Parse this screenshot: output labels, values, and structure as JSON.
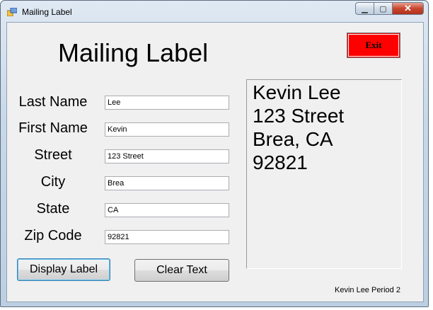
{
  "window": {
    "title": "Mailing Label",
    "minimize_glyph": "▁",
    "maximize_glyph": "▢",
    "close_glyph": "✕"
  },
  "form": {
    "heading": "Mailing Label",
    "exit_label": "Exit",
    "fields": {
      "last_name": {
        "label": "Last Name",
        "value": "Lee"
      },
      "first_name": {
        "label": "First Name",
        "value": "Kevin"
      },
      "street": {
        "label": "Street",
        "value": "123 Street"
      },
      "city": {
        "label": "City",
        "value": "Brea"
      },
      "state": {
        "label": "State",
        "value": "CA"
      },
      "zip": {
        "label": "Zip Code",
        "value": "92821"
      }
    },
    "display": {
      "line1": "Kevin Lee",
      "line2": "123 Street",
      "line3": "Brea, CA",
      "line4": "92821"
    },
    "display_button": "Display Label",
    "clear_button": "Clear Text",
    "footer": "Kevin Lee Period 2"
  },
  "colors": {
    "exit_button": "#ff0000",
    "client_background": "#f0f0f0"
  }
}
